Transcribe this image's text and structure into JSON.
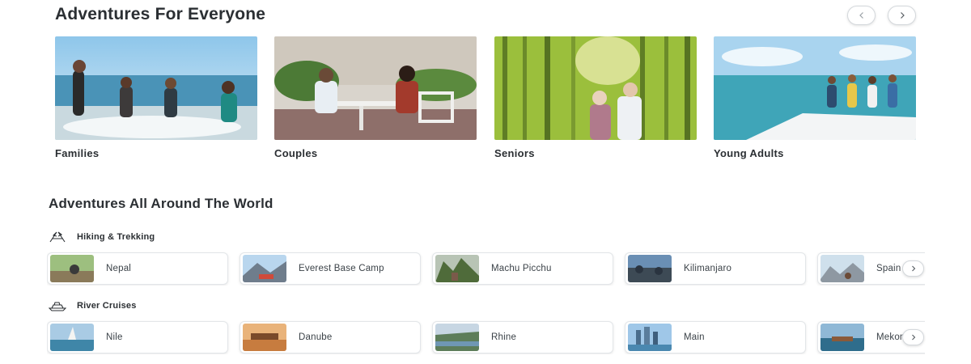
{
  "adventures_for_everyone": {
    "title": "Adventures For Everyone",
    "cards": [
      {
        "label": "Families",
        "image": "family-beach-photo"
      },
      {
        "label": "Couples",
        "image": "couple-dining-photo"
      },
      {
        "label": "Seniors",
        "image": "seniors-bamboo-forest-photo"
      },
      {
        "label": "Young Adults",
        "image": "young-adults-boat-photo"
      }
    ],
    "prev_icon": "chevron-left-icon",
    "next_icon": "chevron-right-icon"
  },
  "adventures_around_world": {
    "title": "Adventures All Around The World",
    "categories": [
      {
        "label": "Hiking & Trekking",
        "icon": "hiking-flags-icon",
        "destinations": [
          "Nepal",
          "Everest Base Camp",
          "Machu Picchu",
          "Kilimanjaro",
          "Spain"
        ]
      },
      {
        "label": "River Cruises",
        "icon": "cruise-ship-icon",
        "destinations": [
          "Nile",
          "Danube",
          "Rhine",
          "Main",
          "Mekong"
        ]
      }
    ]
  }
}
